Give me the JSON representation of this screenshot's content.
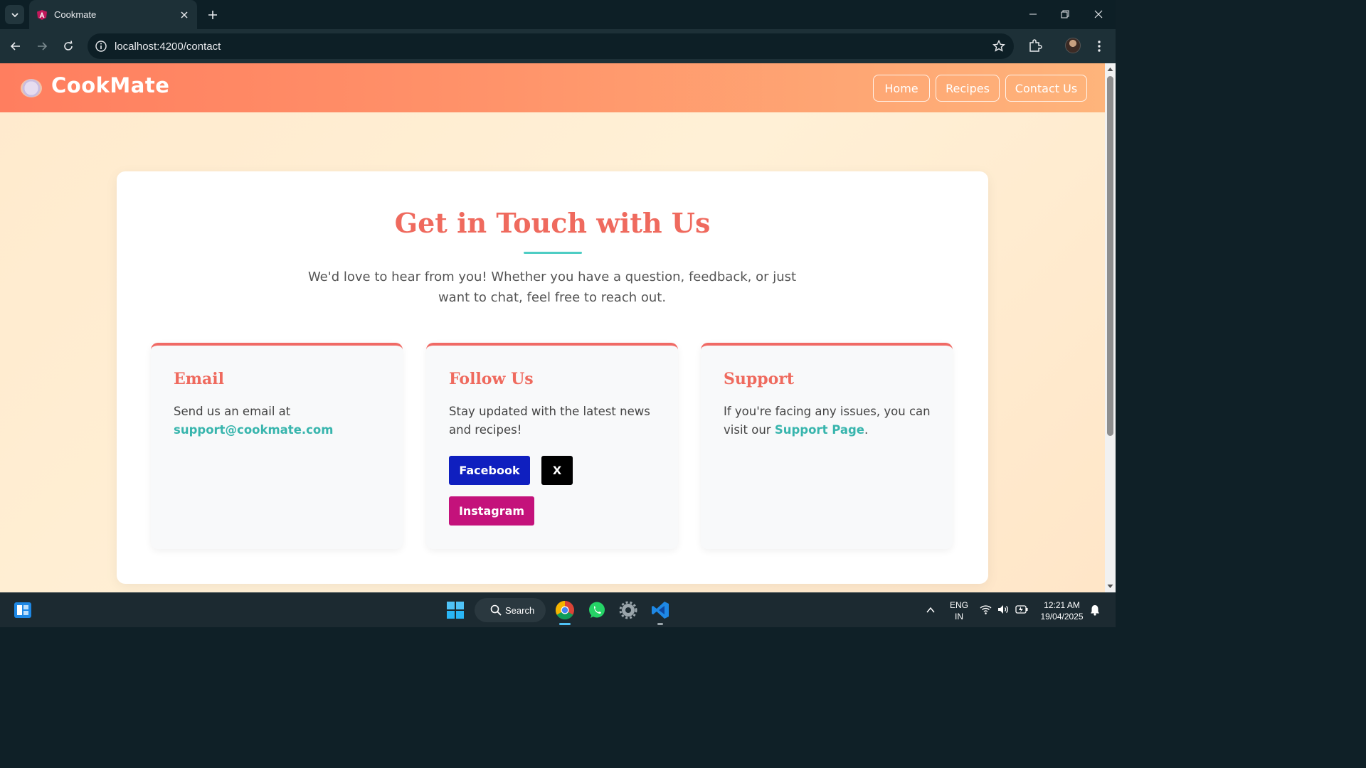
{
  "browser": {
    "tab_title": "Cookmate",
    "url": "localhost:4200/contact"
  },
  "site": {
    "brand": "CookMate",
    "nav": [
      {
        "label": "Home"
      },
      {
        "label": "Recipes"
      },
      {
        "label": "Contact Us"
      }
    ]
  },
  "contact": {
    "title": "Get in Touch with Us",
    "intro": "We'd love to hear from you! Whether you have a question, feedback, or just want to chat, feel free to reach out.",
    "email": {
      "title": "Email",
      "text": "Send us an email at",
      "link": "support@cookmate.com"
    },
    "follow": {
      "title": "Follow Us",
      "text": "Stay updated with the latest news and recipes!",
      "buttons": {
        "facebook": {
          "label": "Facebook",
          "color": "#0f1fbf"
        },
        "x": {
          "label": "X",
          "color": "#000000"
        },
        "instagram": {
          "label": "Instagram",
          "color": "#c4127b"
        }
      }
    },
    "support": {
      "title": "Support",
      "text_before": "If you're facing any issues, you can visit our",
      "link": "Support Page",
      "text_after": "."
    }
  },
  "colors": {
    "header_gradient_start": "#ff7e5f",
    "header_gradient_end": "#feb47b",
    "title": "#ef6a5e",
    "accent_teal": "#4ecdc4"
  },
  "taskbar": {
    "search_label": "Search",
    "lang_line1": "ENG",
    "lang_line2": "IN",
    "time": "12:21 AM",
    "date": "19/04/2025"
  }
}
